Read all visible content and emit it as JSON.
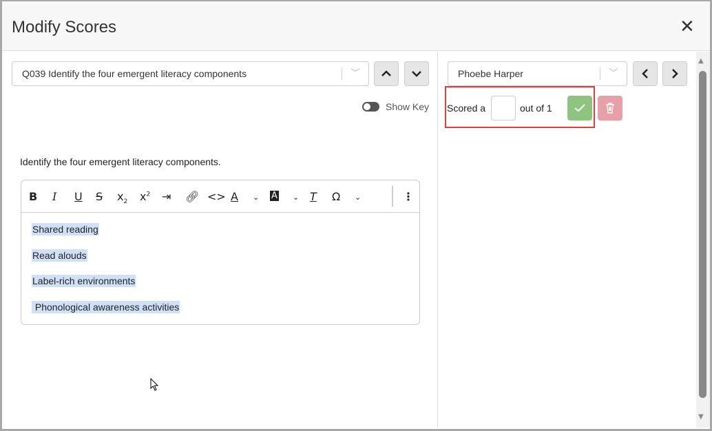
{
  "dialog": {
    "title": "Modify Scores",
    "close_icon": "close-icon"
  },
  "question": {
    "selected": "Q039 Identify the four emergent literacy components",
    "show_key_label": "Show Key",
    "show_key_on": false,
    "prompt": "Identify the four emergent literacy components.",
    "toolbar": [
      "bold",
      "italic",
      "underline",
      "strikethrough",
      "subscript",
      "superscript",
      "indent",
      "link",
      "code",
      "text-color",
      "highlight-color",
      "clear-format",
      "special-character",
      "more"
    ],
    "answer_lines": [
      "Shared reading",
      "Read alouds",
      "Label-rich environments",
      " Phonological awareness activities"
    ]
  },
  "student": {
    "selected": "Phoebe Harper"
  },
  "score": {
    "prefix": "Scored a",
    "value": "",
    "suffix": "out of 1"
  },
  "colors": {
    "save": "#8fc380",
    "delete": "#e8a0a8",
    "highlight": "#e83a3a"
  }
}
